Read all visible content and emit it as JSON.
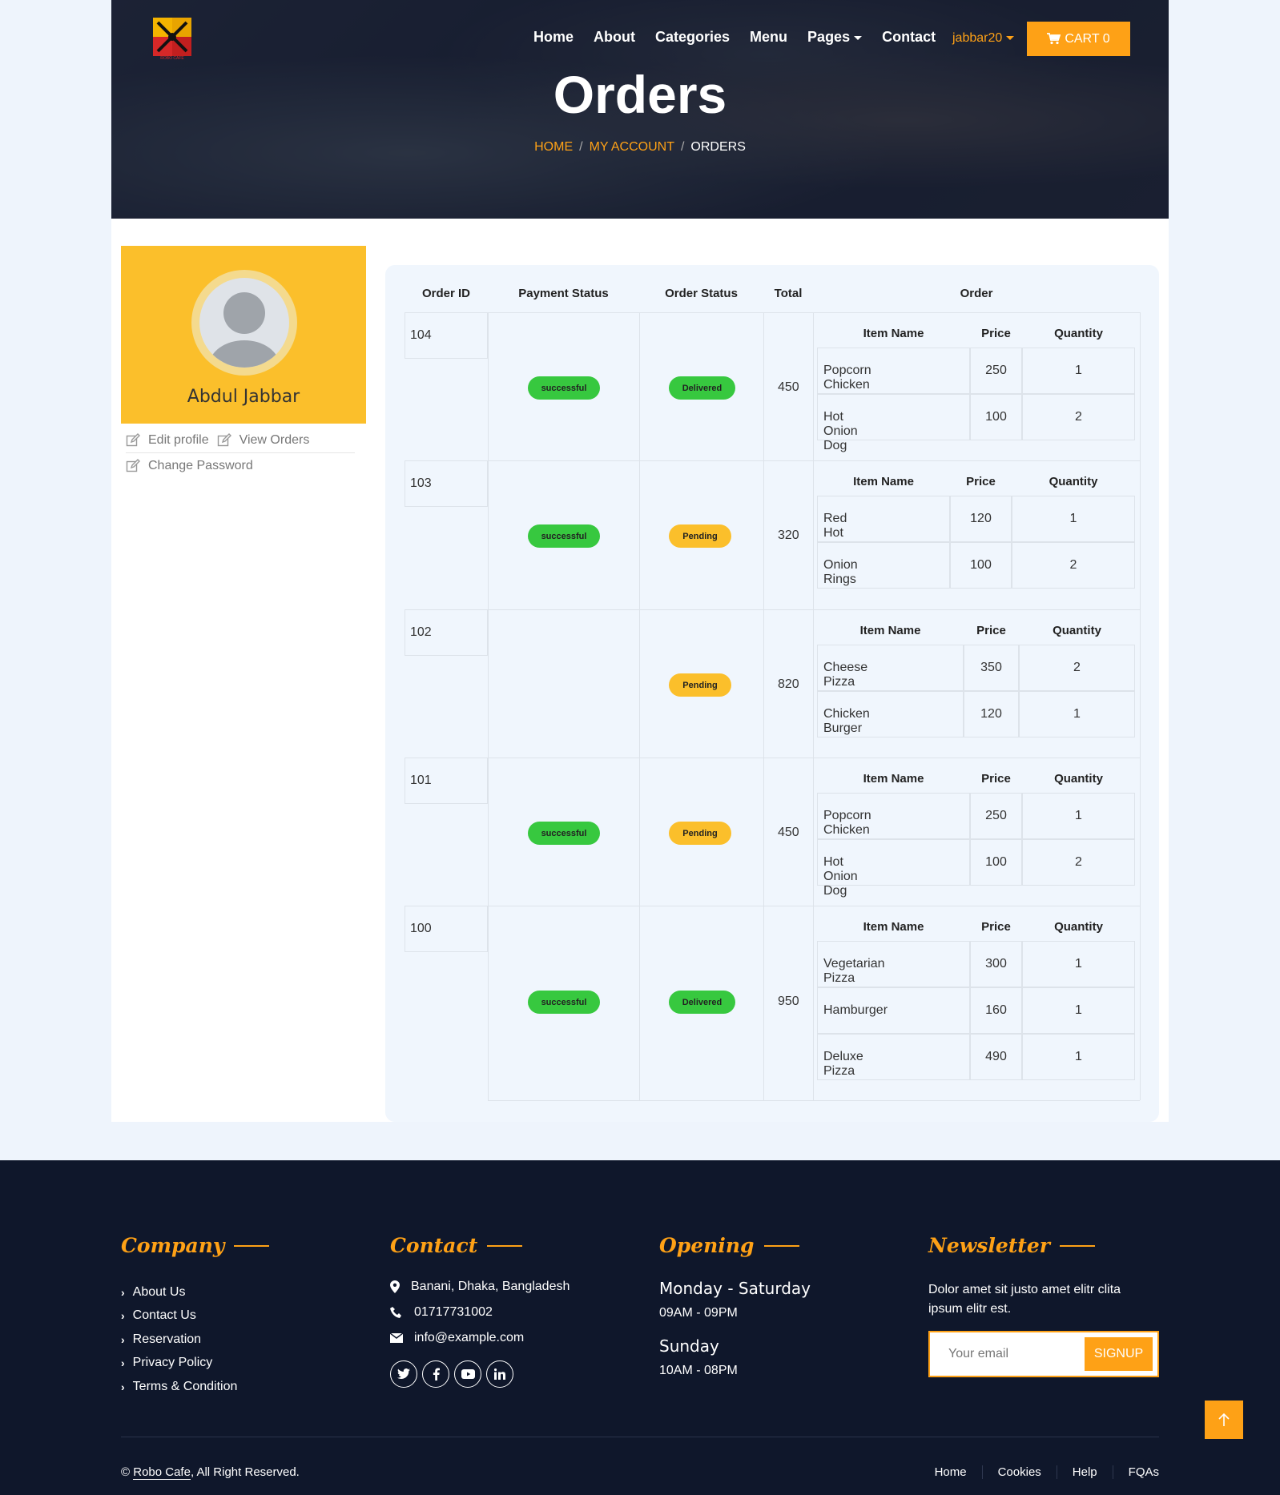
{
  "nav": {
    "items": [
      "Home",
      "About",
      "Categories",
      "Menu",
      "Pages",
      "Contact"
    ],
    "user": "jabbar20",
    "cart": "CART 0"
  },
  "hero": {
    "title": "Orders",
    "breadcrumb": [
      "HOME",
      "MY ACCOUNT",
      "ORDERS"
    ],
    "breadcrumb_sep": "/"
  },
  "profile": {
    "name": "Abdul Jabbar",
    "links": [
      "Edit profile",
      "View Orders",
      "Change Password"
    ]
  },
  "orders_table": {
    "headers": [
      "Order ID",
      "Payment Status",
      "Order Status",
      "Total",
      "Order"
    ],
    "item_headers": [
      "Item Name",
      "Price",
      "Quantity"
    ],
    "orders": [
      {
        "id": "104",
        "payment": "successful",
        "status": "Delivered",
        "total": "450",
        "items": [
          {
            "name": "Popcorn Chicken",
            "price": "250",
            "qty": "1"
          },
          {
            "name": "Hot Onion Dog",
            "price": "100",
            "qty": "2"
          }
        ]
      },
      {
        "id": "103",
        "payment": "successful",
        "status": "Pending",
        "total": "320",
        "items": [
          {
            "name": "Red Hot",
            "price": "120",
            "qty": "1"
          },
          {
            "name": "Onion Rings",
            "price": "100",
            "qty": "2"
          }
        ]
      },
      {
        "id": "102",
        "payment": "",
        "status": "Pending",
        "total": "820",
        "items": [
          {
            "name": "Cheese Pizza",
            "price": "350",
            "qty": "2"
          },
          {
            "name": "Chicken Burger",
            "price": "120",
            "qty": "1"
          }
        ]
      },
      {
        "id": "101",
        "payment": "successful",
        "status": "Pending",
        "total": "450",
        "items": [
          {
            "name": "Popcorn Chicken",
            "price": "250",
            "qty": "1"
          },
          {
            "name": "Hot Onion Dog",
            "price": "100",
            "qty": "2"
          }
        ]
      },
      {
        "id": "100",
        "payment": "successful",
        "status": "Delivered",
        "total": "950",
        "items": [
          {
            "name": "Vegetarian Pizza",
            "price": "300",
            "qty": "1"
          },
          {
            "name": "Hamburger",
            "price": "160",
            "qty": "1"
          },
          {
            "name": "Deluxe Pizza",
            "price": "490",
            "qty": "1"
          }
        ]
      }
    ]
  },
  "footer": {
    "company": {
      "title": "Company",
      "links": [
        "About Us",
        "Contact Us",
        "Reservation",
        "Privacy Policy",
        "Terms & Condition"
      ]
    },
    "contact": {
      "title": "Contact",
      "address": "Banani, Dhaka, Bangladesh",
      "phone": "01717731002",
      "email": "info@example.com",
      "social": [
        "twitter-icon",
        "facebook-icon",
        "youtube-icon",
        "linkedin-icon"
      ]
    },
    "opening": {
      "title": "Opening",
      "day1": "Monday - Saturday",
      "time1": "09AM - 09PM",
      "day2": "Sunday",
      "time2": "10AM - 08PM"
    },
    "newsletter": {
      "title": "Newsletter",
      "text": "Dolor amet sit justo amet elitr clita ipsum elitr est.",
      "placeholder": "Your email",
      "button": "SIGNUP"
    },
    "copyright_prefix": "©",
    "brand": "Robo Cafe",
    "copyright_suffix": ", All Right Reserved.",
    "menu": [
      "Home",
      "Cookies",
      "Help",
      "FQAs"
    ]
  },
  "colors": {
    "accent": "#fea116",
    "profile_bg": "#fbbf2b",
    "success": "#37c83f",
    "dark": "#0f172b"
  }
}
